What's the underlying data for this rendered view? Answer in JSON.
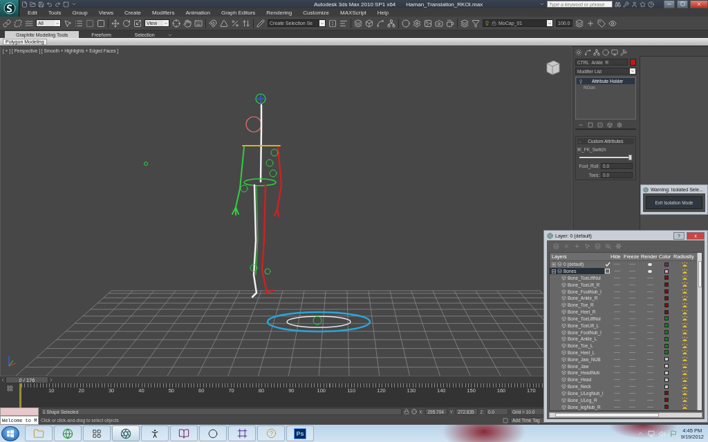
{
  "window": {
    "app_title": "Autodesk 3ds Max 2010 SP1 x64",
    "file_name": "Haman_Translation_RKOI.max"
  },
  "search": {
    "placeholder": "Type a keyword or phrase"
  },
  "menu": [
    "Edit",
    "Tools",
    "Group",
    "Views",
    "Create",
    "Modifiers",
    "Animation",
    "Graph Editors",
    "Rendering",
    "Customize",
    "MAXScript",
    "Help"
  ],
  "toolbar": {
    "selection_filter": "All",
    "reference_coord": "View",
    "named_selection": "Create Selection Se",
    "layer": "MoCap_01",
    "spinner": "100.0"
  },
  "ribbon": {
    "tabs": [
      {
        "label": "Graphite Modeling Tools",
        "selected": true
      },
      {
        "label": "Freeform",
        "selected": false
      },
      {
        "label": "Selection",
        "selected": false
      }
    ],
    "panel": "Polygon Modeling"
  },
  "viewport": {
    "label": "[ + ] [ Perspective ] [ Smooth + Highlights + Edged Faces ]"
  },
  "command_panel": {
    "object_name": "CTRL_Ankle_R",
    "modifier_list": "Modifier List",
    "stack": [
      {
        "label": "Attribute Holder",
        "selected": true
      },
      {
        "label": "NGon",
        "selected": false
      }
    ],
    "rollout": {
      "toggle": "-",
      "title": "Custom Attributes",
      "slider": {
        "label": "IK_FK_Switch:",
        "level": 1.0
      },
      "spinners": [
        {
          "label": "Foot_Roll:",
          "value": "0.0"
        },
        {
          "label": "Toes:",
          "value": "0.0"
        }
      ]
    }
  },
  "warning": {
    "title": "Warning: Isolated Sele...",
    "button": "Exit Isolation Mode"
  },
  "layer_dialog": {
    "title": "Layer: 0 (default)",
    "help": "?",
    "close": "x",
    "columns": [
      "Layers",
      "Hide",
      "Freeze",
      "Render",
      "Color",
      "Radiosity"
    ],
    "rows": [
      {
        "kind": "layer",
        "name": "0 (default)",
        "current": true,
        "selected": false,
        "expanded": false,
        "hidden": false,
        "frozen": false,
        "render": true,
        "color": "#8a1a78"
      },
      {
        "kind": "layer",
        "name": "Bones",
        "current": false,
        "selected": true,
        "expanded": true,
        "hidden": false,
        "frozen": false,
        "render": true,
        "color": "#e0a0d8",
        "children": [
          {
            "kind": "object",
            "name": "Bone_ToeLiftNul",
            "hidden": false,
            "frozen": false,
            "render": false,
            "color": "#8b0a0a"
          },
          {
            "kind": "object",
            "name": "Bone_ToeLift_R",
            "hidden": false,
            "frozen": false,
            "render": false,
            "color": "#8b0a0a"
          },
          {
            "kind": "object",
            "name": "Bone_FootNub_l",
            "hidden": false,
            "frozen": false,
            "render": false,
            "color": "#8b0a0a"
          },
          {
            "kind": "object",
            "name": "Bone_Ankle_R",
            "hidden": false,
            "frozen": false,
            "render": false,
            "color": "#8b0a0a"
          },
          {
            "kind": "object",
            "name": "Bone_Toe_R",
            "hidden": false,
            "frozen": false,
            "render": false,
            "color": "#8b0a0a"
          },
          {
            "kind": "object",
            "name": "Bone_Heel_R",
            "hidden": false,
            "frozen": false,
            "render": false,
            "color": "#8b0a0a"
          },
          {
            "kind": "object",
            "name": "Bone_ToeLiftNul",
            "hidden": false,
            "frozen": false,
            "render": false,
            "color": "#0a8a0a"
          },
          {
            "kind": "object",
            "name": "Bone_ToeLift_L",
            "hidden": false,
            "frozen": false,
            "render": false,
            "color": "#0a8a0a"
          },
          {
            "kind": "object",
            "name": "Bone_FootNub_l",
            "hidden": false,
            "frozen": false,
            "render": false,
            "color": "#0a8a0a"
          },
          {
            "kind": "object",
            "name": "Bone_Ankle_L",
            "hidden": false,
            "frozen": false,
            "render": false,
            "color": "#0a8a0a"
          },
          {
            "kind": "object",
            "name": "Bone_Toe_L",
            "hidden": false,
            "frozen": false,
            "render": false,
            "color": "#0a8a0a"
          },
          {
            "kind": "object",
            "name": "Bone_Heel_L",
            "hidden": false,
            "frozen": false,
            "render": false,
            "color": "#0a8a0a"
          },
          {
            "kind": "object",
            "name": "Bone_Jaw_NUB",
            "hidden": false,
            "frozen": false,
            "render": false,
            "color": "#c8c8d0"
          },
          {
            "kind": "object",
            "name": "Bone_Jaw",
            "hidden": false,
            "frozen": false,
            "render": false,
            "color": "#c8c8d0"
          },
          {
            "kind": "object",
            "name": "Bone_HeadNub",
            "hidden": false,
            "frozen": false,
            "render": false,
            "color": "#c8c8d0"
          },
          {
            "kind": "object",
            "name": "Bone_Head",
            "hidden": false,
            "frozen": false,
            "render": false,
            "color": "#c8c8d0"
          },
          {
            "kind": "object",
            "name": "Bone_Neck",
            "hidden": false,
            "frozen": false,
            "render": false,
            "color": "#c8c8d0"
          },
          {
            "kind": "object",
            "name": "Bone_ULegNub_l",
            "hidden": false,
            "frozen": false,
            "render": false,
            "color": "#8b0a0a"
          },
          {
            "kind": "object",
            "name": "Bone_ULeg_R",
            "hidden": false,
            "frozen": false,
            "render": false,
            "color": "#8b0a0a"
          },
          {
            "kind": "object",
            "name": "Bone_legNub_R",
            "hidden": false,
            "frozen": false,
            "render": false,
            "color": "#8b0a0a"
          }
        ]
      }
    ]
  },
  "timeline": {
    "position": "0 / 176",
    "ticks": [
      "10",
      "20",
      "30",
      "40",
      "50",
      "60",
      "70",
      "80",
      "90",
      "100",
      "110",
      "120",
      "130",
      "140",
      "150",
      "160",
      "170"
    ]
  },
  "status": {
    "listener": "Welcome to M",
    "selection": "1 Shape Selected",
    "prompt": "Click or click-and-drag to select objects",
    "coords": [
      {
        "label": "X:",
        "value": "295.704"
      },
      {
        "label": "Y:",
        "value": "272.835"
      },
      {
        "label": "Z:",
        "value": "0.0"
      }
    ],
    "grid": "Grid = 10.0",
    "time_tag": "Add Time Tag"
  },
  "taskbar": {
    "buttons": [
      {
        "kind": "folder",
        "selected": false
      },
      {
        "kind": "browser",
        "selected": false
      },
      {
        "kind": "grid",
        "selected": false
      },
      {
        "kind": "max",
        "selected": true
      },
      {
        "kind": "figure",
        "selected": false
      },
      {
        "kind": "books",
        "selected": false
      },
      {
        "kind": "swirl",
        "selected": false
      },
      {
        "kind": "frame",
        "selected": false
      },
      {
        "kind": "help",
        "selected": false
      },
      {
        "kind": "photoshop",
        "selected": false,
        "label": "Ps"
      }
    ],
    "time": "4:45 PM",
    "date": "9/19/2012"
  }
}
